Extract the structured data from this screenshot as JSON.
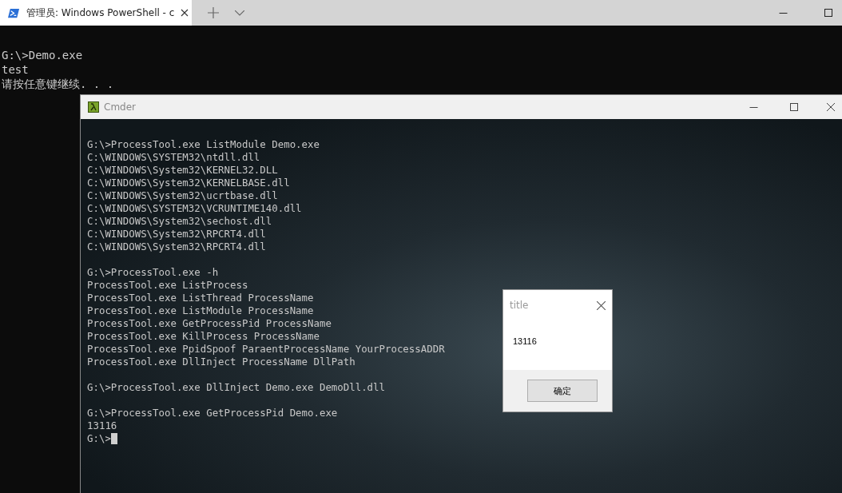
{
  "terminal_window": {
    "tab": {
      "title": "管理员: Windows PowerShell - c",
      "selected": true
    },
    "lines": [
      "G:\\>Demo.exe",
      "test",
      "请按任意键继续. . ."
    ]
  },
  "cmder_window": {
    "title": "Cmder",
    "blocks": [
      [
        "G:\\>ProcessTool.exe ListModule Demo.exe",
        "C:\\WINDOWS\\SYSTEM32\\ntdll.dll",
        "C:\\WINDOWS\\System32\\KERNEL32.DLL",
        "C:\\WINDOWS\\System32\\KERNELBASE.dll",
        "C:\\WINDOWS\\System32\\ucrtbase.dll",
        "C:\\WINDOWS\\SYSTEM32\\VCRUNTIME140.dll",
        "C:\\WINDOWS\\System32\\sechost.dll",
        "C:\\WINDOWS\\System32\\RPCRT4.dll",
        "C:\\WINDOWS\\System32\\RPCRT4.dll"
      ],
      [
        "G:\\>ProcessTool.exe -h",
        "ProcessTool.exe ListProcess",
        "ProcessTool.exe ListThread ProcessName",
        "ProcessTool.exe ListModule ProcessName",
        "ProcessTool.exe GetProcessPid ProcessName",
        "ProcessTool.exe KillProcess ProcessName",
        "ProcessTool.exe PpidSpoof ParaentProcessName YourProcessADDR",
        "ProcessTool.exe DllInject ProcessName DllPath"
      ],
      [
        "G:\\>ProcessTool.exe DllInject Demo.exe DemoDll.dll"
      ],
      [
        "G:\\>ProcessTool.exe GetProcessPid Demo.exe",
        "13116",
        "G:\\>"
      ]
    ],
    "cursor": true
  },
  "message_box": {
    "title": "title",
    "message": "13116",
    "buttons": [
      "确定"
    ]
  }
}
